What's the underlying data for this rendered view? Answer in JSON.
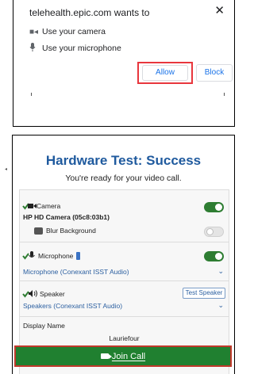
{
  "permission": {
    "title": "telehealth.epic.com wants to",
    "camera_text": "Use your camera",
    "mic_text": "Use your microphone",
    "allow_label": "Allow",
    "block_label": "Block",
    "close_icon": "close-icon",
    "accent": "#1a73e8",
    "highlight": "#e8363d"
  },
  "hardware": {
    "title": "Hardware Test: Success",
    "subtitle": "You're ready for your video call.",
    "camera": {
      "label": "Camera",
      "device": "HP HD Camera (05c8:03b1)",
      "enabled": true
    },
    "blur": {
      "label": "Blur Background",
      "enabled": false
    },
    "microphone": {
      "label": "Microphone",
      "device": "Microphone (Conexant ISST Audio)",
      "enabled": true
    },
    "speaker": {
      "label": "Speaker",
      "device": "Speakers (Conexant ISST Audio)",
      "test_label": "Test Speaker"
    },
    "display_name": {
      "label": "Display Name",
      "value": "Lauriefour"
    },
    "join_label": "Join Call",
    "title_color": "#1f5a9e",
    "toggle_on_color": "#2e7d32",
    "join_color": "#208030"
  }
}
